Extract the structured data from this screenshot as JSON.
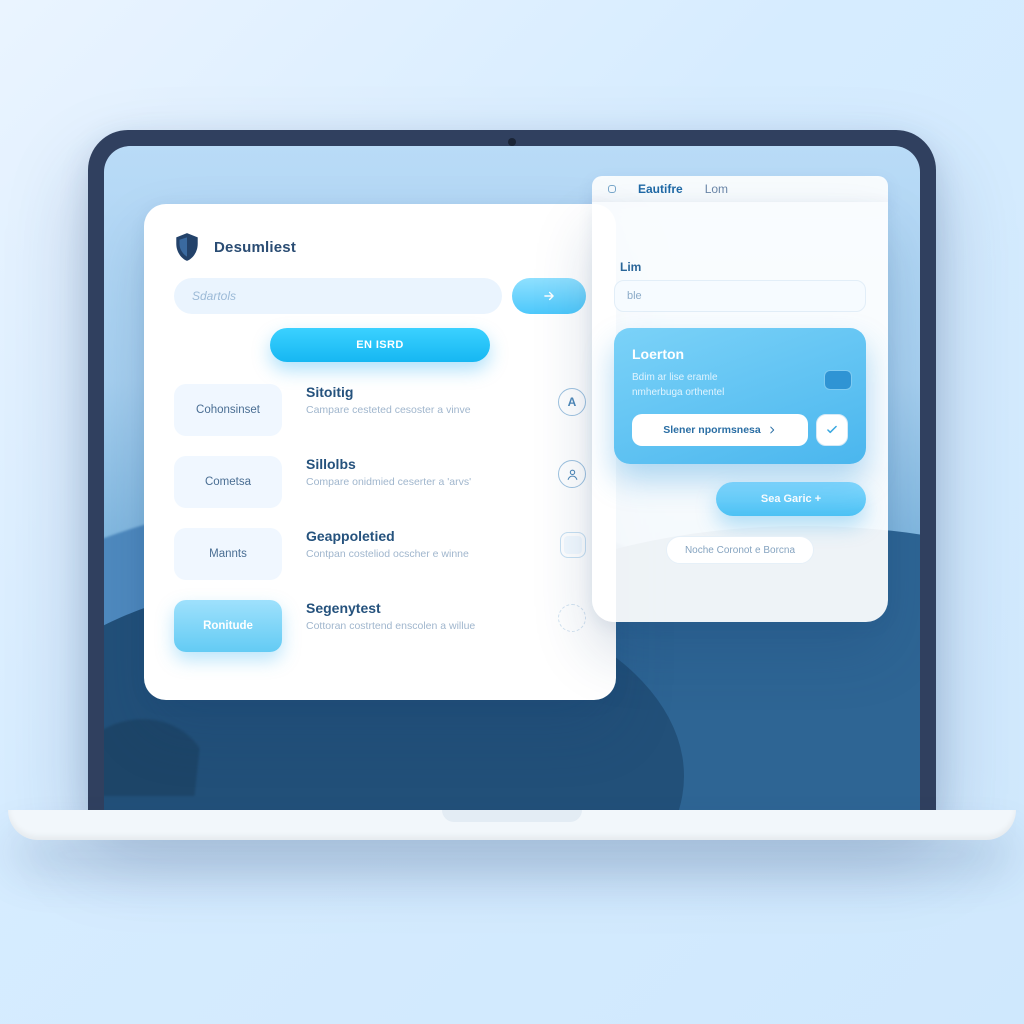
{
  "brand": {
    "title": "Desumliest"
  },
  "search": {
    "placeholder": "Sdartols"
  },
  "primary_button": "EN ISRD",
  "list": [
    {
      "chip": "Cohonsinset",
      "title": "Sitoitig",
      "sub": "Campare cesteted cesoster a vinve",
      "badge": "A"
    },
    {
      "chip": "Cometsa",
      "title": "Sillolbs",
      "sub": "Compare onidmied ceserter a 'arvs'",
      "badge_icon": "account"
    },
    {
      "chip": "Mannts",
      "title": "Geappoletied",
      "sub": "Contpan costeliod ocscher e winne",
      "badge_icon": "square"
    },
    {
      "chip": "Ronitude",
      "title": "Segenytest",
      "sub": "Cottoran costrtend enscolen a willue",
      "badge_icon": "empty",
      "highlight": true
    }
  ],
  "top_tabs": {
    "items": [
      "Eautifre",
      "Lom"
    ],
    "active_index": 0
  },
  "right": {
    "field_label": "Lim",
    "field_value": "ble",
    "card": {
      "heading": "Loerton",
      "line1": "Bdim ar lise eramle",
      "line2": "nmherbuga orthentel",
      "action_label": "Slener npormsnesa",
      "check": "✓"
    },
    "secondary_button": "Sea Garic +",
    "hint": "Noche Coronot e Borcna"
  },
  "colors": {
    "accent": "#2fbaf0",
    "accent_dark": "#1a8fc7",
    "text": "#2a4c73",
    "muted": "#8fb0cf"
  }
}
